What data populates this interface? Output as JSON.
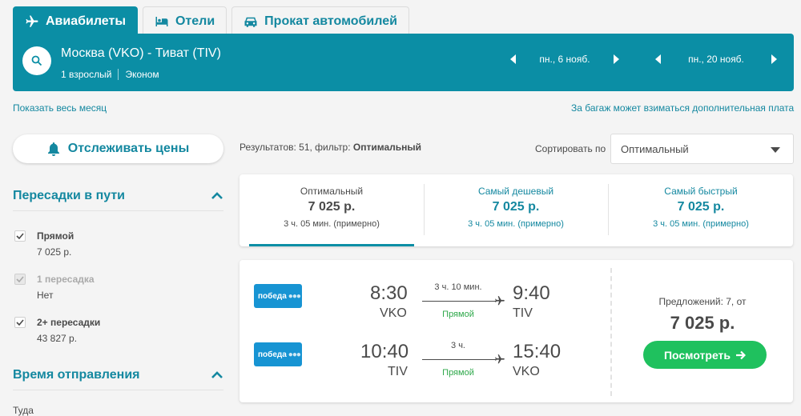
{
  "tabs": [
    {
      "label": "Авиабилеты",
      "icon": "plane-icon"
    },
    {
      "label": "Отели",
      "icon": "bed-icon"
    },
    {
      "label": "Прокат автомобилей",
      "icon": "car-icon"
    }
  ],
  "search": {
    "route": "Москва (VKO) - Тиват (TIV)",
    "passengers": "1 взрослый",
    "cabin": "Эконом",
    "depart_date": "пн., 6 нояб.",
    "return_date": "пн., 20 нояб."
  },
  "links": {
    "show_month": "Показать весь месяц",
    "baggage_note": "За багаж может взиматься дополнительная плата"
  },
  "track_button": "Отслеживать цены",
  "filters": {
    "stops_title": "Пересадки в пути",
    "stops": [
      {
        "label": "Прямой",
        "price": "7 025 р.",
        "checked": true,
        "disabled": false
      },
      {
        "label": "1 пересадка",
        "price": "Нет",
        "checked": true,
        "disabled": true
      },
      {
        "label": "2+ пересадки",
        "price": "43 827 р.",
        "checked": true,
        "disabled": false
      }
    ],
    "departure_title": "Время отправления",
    "departure_sub": "Туда"
  },
  "results": {
    "prefix": "Результатов: 51, фильтр: ",
    "filter": "Оптимальный"
  },
  "sort": {
    "label": "Сортировать по",
    "selected": "Оптимальный"
  },
  "sort_tabs": [
    {
      "title": "Оптимальный",
      "price": "7 025 р.",
      "duration": "3 ч. 05 мин. (примерно)",
      "active": true
    },
    {
      "title": "Самый дешевый",
      "price": "7 025 р.",
      "duration": "3 ч. 05 мин. (примерно)",
      "active": false
    },
    {
      "title": "Самый быстрый",
      "price": "7 025 р.",
      "duration": "3 ч. 05 мин. (примерно)",
      "active": false
    }
  ],
  "flight": {
    "legs": [
      {
        "airline": "победа",
        "dep_time": "8:30",
        "dep_code": "VKO",
        "duration": "3 ч. 10 мин.",
        "stops": "Прямой",
        "arr_time": "9:40",
        "arr_code": "TIV"
      },
      {
        "airline": "победа",
        "dep_time": "10:40",
        "dep_code": "TIV",
        "duration": "3 ч.",
        "stops": "Прямой",
        "arr_time": "15:40",
        "arr_code": "VKO"
      }
    ],
    "offers": "Предложений: 7, от",
    "price": "7 025 р.",
    "view_button": "Посмотреть"
  },
  "colors": {
    "brand": "#0b8ea5",
    "link": "#1488a0",
    "cta": "#1fc15e",
    "airline": "#1794d3",
    "direct": "#2ea84a"
  }
}
